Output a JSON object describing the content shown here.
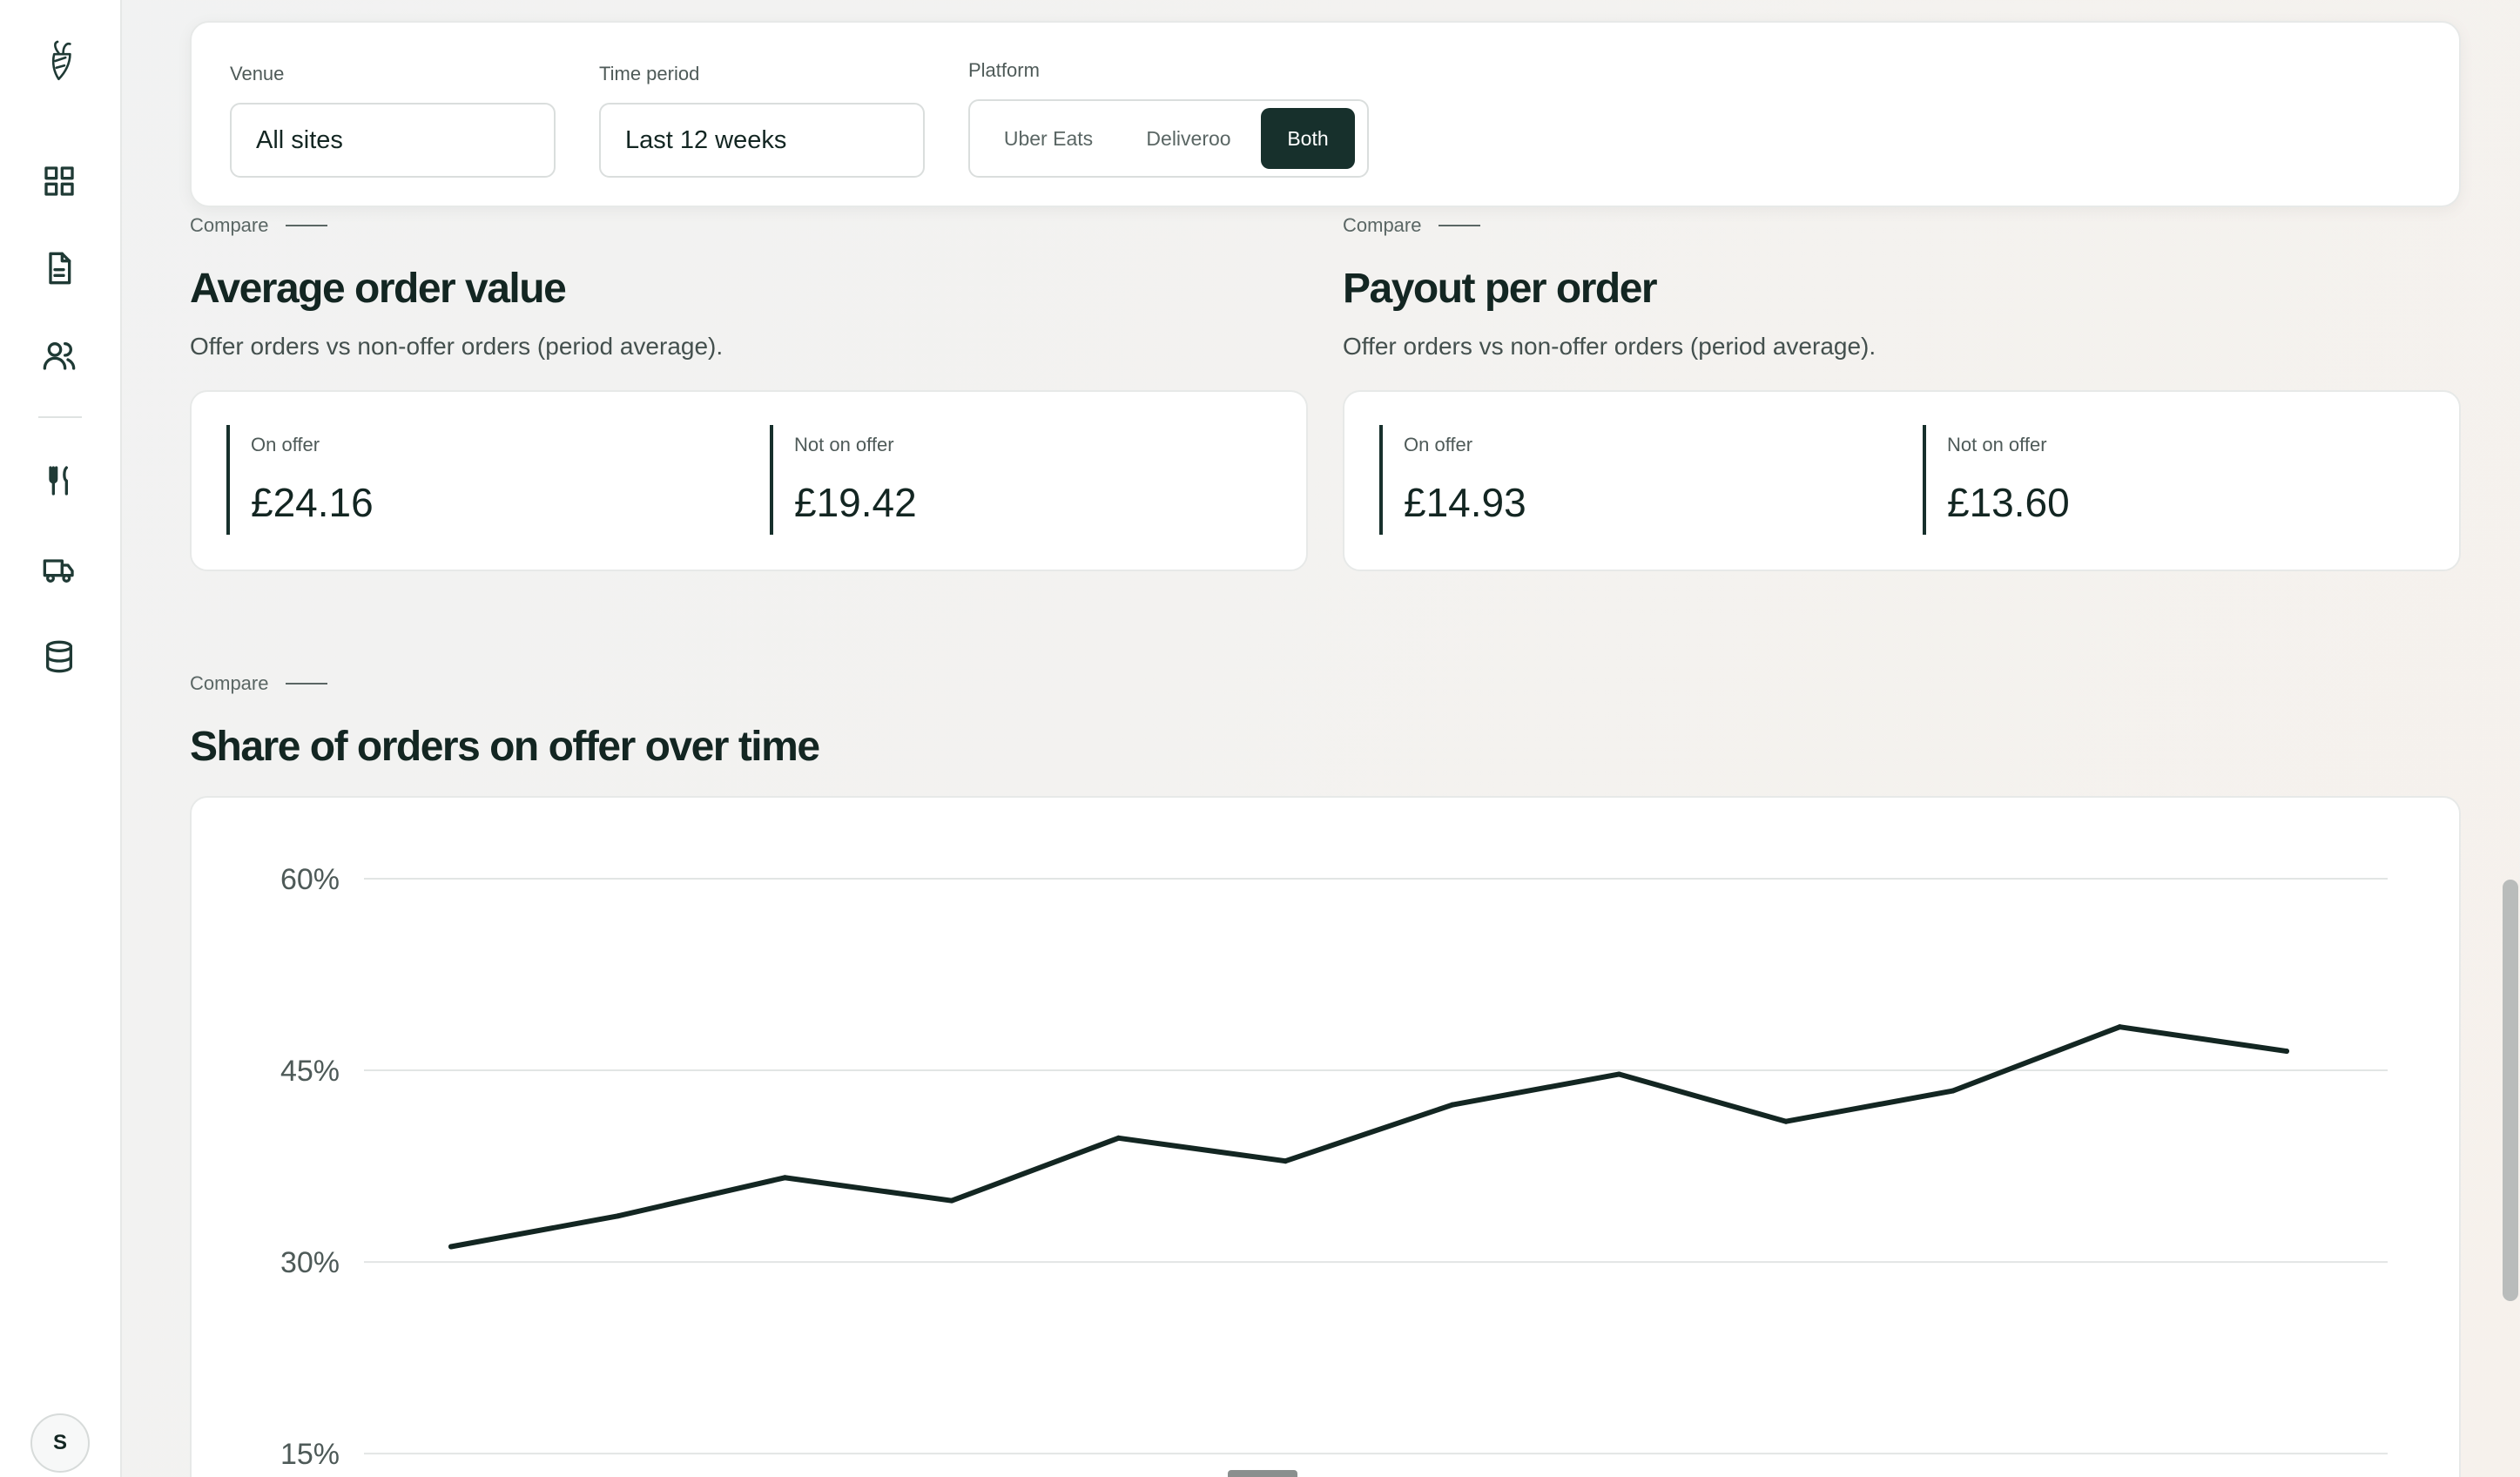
{
  "sidebar": {
    "logo": "carrot-logo",
    "items": [
      {
        "name": "dashboard",
        "icon": "grid-icon"
      },
      {
        "name": "reports",
        "icon": "document-icon"
      },
      {
        "name": "customers",
        "icon": "users-icon"
      },
      {
        "name": "menu",
        "icon": "cutlery-icon"
      },
      {
        "name": "delivery",
        "icon": "truck-icon"
      },
      {
        "name": "data",
        "icon": "database-icon"
      }
    ],
    "avatar_initial": "S"
  },
  "filters": {
    "venue_label": "Venue",
    "venue_value": "All sites",
    "time_label": "Time period",
    "time_value": "Last 12 weeks",
    "platform_label": "Platform",
    "platform_options": [
      "Uber Eats",
      "Deliveroo",
      "Both"
    ],
    "platform_selected": "Both"
  },
  "aov": {
    "kicker": "Compare",
    "title": "Average order value",
    "subtitle": "Offer orders vs non-offer orders (period average).",
    "on_offer_label": "On offer",
    "on_offer_value": "£24.16",
    "not_offer_label": "Not on offer",
    "not_offer_value": "£19.42"
  },
  "payout": {
    "kicker": "Compare",
    "title": "Payout per order",
    "subtitle": "Offer orders vs non-offer orders (period average).",
    "on_offer_label": "On offer",
    "on_offer_value": "£14.93",
    "not_offer_label": "Not on offer",
    "not_offer_value": "£13.60"
  },
  "share": {
    "kicker": "Compare",
    "title": "Share of orders on offer over time"
  },
  "colors": {
    "accent_dark": "#17302c",
    "line": "#132622"
  },
  "chart_data": {
    "type": "line",
    "title": "",
    "xlabel": "",
    "ylabel": "",
    "ylim": [
      15,
      60
    ],
    "yticks": [
      "60%",
      "45%",
      "30%",
      "15%"
    ],
    "ytick_values": [
      60,
      45,
      30,
      15
    ],
    "grid": true,
    "x": [
      1,
      2,
      3,
      4,
      5,
      6,
      7,
      8,
      9,
      10,
      11,
      12
    ],
    "series": [
      {
        "values": [
          31.2,
          33.6,
          36.6,
          34.8,
          39.7,
          37.9,
          42.3,
          44.7,
          41.0,
          43.4,
          48.4,
          46.5
        ]
      }
    ]
  }
}
